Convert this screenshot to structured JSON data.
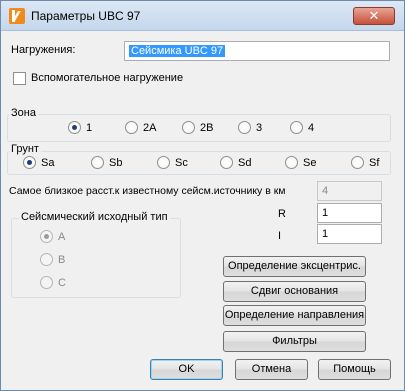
{
  "window": {
    "title": "Параметры UBC 97",
    "close_symbol": "✕"
  },
  "load": {
    "label": "Нагружения:",
    "value": "Сейсмика UBC 97"
  },
  "auxiliary_load": {
    "label": "Вспомогательное нагружение",
    "checked": false
  },
  "zone": {
    "title": "Зона",
    "options": [
      "1",
      "2A",
      "2B",
      "3",
      "4"
    ],
    "selected": "1"
  },
  "soil": {
    "title": "Грунт",
    "options": [
      "Sa",
      "Sb",
      "Sc",
      "Sd",
      "Se",
      "Sf"
    ],
    "selected": "Sa"
  },
  "nearest_distance": {
    "label": "Самое близкое расст.к известному сейсм.источнику в км",
    "value": "4"
  },
  "R": {
    "label": "R",
    "value": "1"
  },
  "I": {
    "label": "I",
    "value": "1"
  },
  "seismic_source": {
    "title": "Сейсмический исходный тип",
    "options": [
      "A",
      "B",
      "C"
    ],
    "selected": "A"
  },
  "buttons": {
    "eccentricity": "Определение эксцентрис.",
    "base_shear": "Сдвиг основания",
    "direction": "Определение направления",
    "filters": "Фильтры",
    "ok": "OK",
    "cancel": "Отмена",
    "help": "Помощь"
  }
}
